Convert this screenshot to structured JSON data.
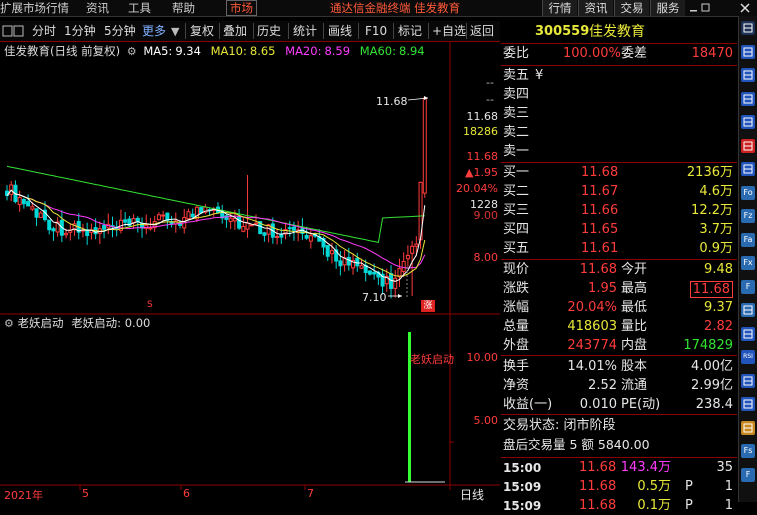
{
  "menu": {
    "items": [
      "扩展市场行情",
      "资讯",
      "工具",
      "帮助"
    ],
    "market_label": "市场",
    "notice": "通达信金融终端 佳发教育",
    "right_buttons": [
      "行情",
      "资讯",
      "交易",
      "服务"
    ]
  },
  "toolbar": {
    "items": [
      "分时",
      "1分钟",
      "5分钟",
      "更多",
      "复权",
      "叠加",
      "历史",
      "统计",
      "画线",
      "F10",
      "标记",
      "+自选",
      "返回"
    ]
  },
  "kline": {
    "title": "佳发教育(日线 前复权)",
    "ma": [
      {
        "label": "MA5:",
        "value": "9.34",
        "color": "#ffffff"
      },
      {
        "label": "MA10:",
        "value": "8.65",
        "color": "#e8e83a"
      },
      {
        "label": "MA20:",
        "value": "8.59",
        "color": "#ff3cff"
      },
      {
        "label": "MA60:",
        "value": "8.94",
        "color": "#33e333"
      }
    ],
    "high_annot": "11.68",
    "low_annot": "7.10",
    "zhang_mark": "涨",
    "s_mark": "S",
    "yaxis": {
      "dash1": "--",
      "dash2": "--",
      "price": "11.68",
      "vol": "18286",
      "price2": "11.68",
      "change": "▲1.95",
      "pct": "20.04%",
      "v2": "1228",
      "tick_mid": "9.00",
      "tick_low": "8.00"
    }
  },
  "indicator": {
    "name": "老妖启动",
    "value_label": "老妖启动: 0.00",
    "annot": "老妖启动",
    "ticks": [
      "10.00",
      "5.00"
    ]
  },
  "xaxis": {
    "labels": [
      "2021年",
      "5",
      "6",
      "7"
    ],
    "period": "日线"
  },
  "quote": {
    "code": "300559",
    "name": "佳发教育",
    "weibi_label": "委比",
    "weibi": "100.00%",
    "weicha_label": "委差",
    "weicha": "18470",
    "sells": [
      {
        "label": "卖五",
        "price": "",
        "vol": "",
        "extra": "¥"
      },
      {
        "label": "卖四",
        "price": "",
        "vol": ""
      },
      {
        "label": "卖三",
        "price": "",
        "vol": ""
      },
      {
        "label": "卖二",
        "price": "",
        "vol": ""
      },
      {
        "label": "卖一",
        "price": "",
        "vol": ""
      }
    ],
    "buys": [
      {
        "label": "买一",
        "price": "11.68",
        "vol": "2136万"
      },
      {
        "label": "买二",
        "price": "11.67",
        "vol": "4.6万"
      },
      {
        "label": "买三",
        "price": "11.66",
        "vol": "12.2万"
      },
      {
        "label": "买四",
        "price": "11.65",
        "vol": "3.7万"
      },
      {
        "label": "买五",
        "price": "11.61",
        "vol": "0.9万"
      }
    ],
    "stats": [
      {
        "l1": "现价",
        "v1": "11.68",
        "c1": "red",
        "l2": "今开",
        "v2": "9.48",
        "c2": "yellow"
      },
      {
        "l1": "涨跌",
        "v1": "1.95",
        "c1": "red",
        "l2": "最高",
        "v2": "11.68",
        "c2": "red"
      },
      {
        "l1": "涨幅",
        "v1": "20.04%",
        "c1": "red",
        "l2": "最低",
        "v2": "9.37",
        "c2": "yellow"
      },
      {
        "l1": "总量",
        "v1": "418603",
        "c1": "yellow",
        "l2": "量比",
        "v2": "2.82",
        "c2": "red"
      },
      {
        "l1": "外盘",
        "v1": "243774",
        "c1": "red",
        "l2": "内盘",
        "v2": "174829",
        "c2": "green"
      }
    ],
    "stats2": [
      {
        "l1": "换手",
        "v1": "14.01%",
        "l2": "股本",
        "v2": "4.00亿"
      },
      {
        "l1": "净资",
        "v1": "2.52",
        "l2": "流通",
        "v2": "2.99亿"
      },
      {
        "l1": "收益(一)",
        "v1": "0.010",
        "l2": "PE(动)",
        "v2": "238.4"
      }
    ],
    "status": "交易状态: 闭市阶段",
    "after_hours": "盘后交易量 5 额 5840.00",
    "ticks": [
      {
        "time": "15:00",
        "price": "11.68",
        "vol": "143.4万",
        "n": "35",
        "vcolor": "mag",
        "flag": ""
      },
      {
        "time": "15:09",
        "price": "11.68",
        "vol": "0.5万",
        "n": "1",
        "vcolor": "yellow",
        "flag": "P"
      },
      {
        "time": "15:09",
        "price": "11.68",
        "vol": "0.1万",
        "n": "1",
        "vcolor": "yellow",
        "flag": "P"
      }
    ]
  },
  "colors": {
    "up": "#ff3c3c",
    "down": "#00d7d7",
    "ma5": "#ffffff",
    "ma10": "#e8e83a",
    "ma20": "#ff3cff",
    "ma60": "#33e333",
    "border": "#8b0000"
  }
}
